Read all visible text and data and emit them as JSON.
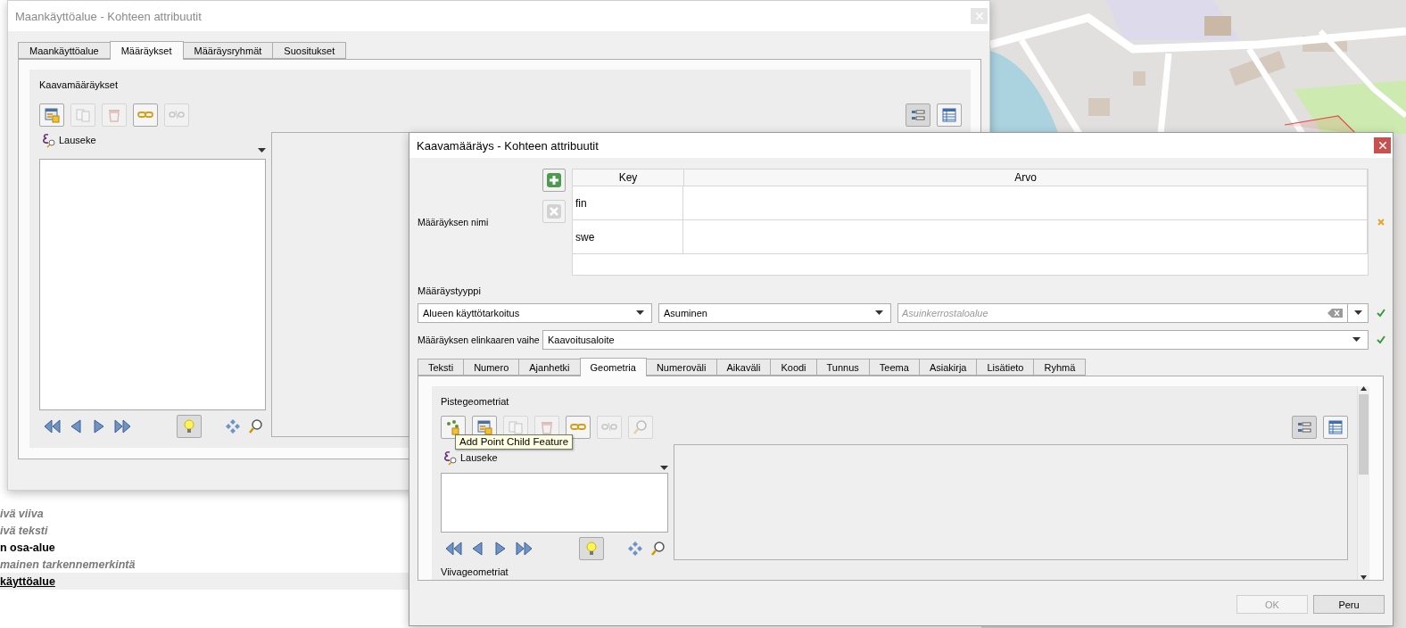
{
  "layers": [
    {
      "label": "ivä viiva",
      "kind": "italic",
      "selected": false
    },
    {
      "label": "ivä teksti",
      "kind": "italic",
      "selected": false
    },
    {
      "label": "n osa-alue",
      "kind": "bold",
      "selected": false
    },
    {
      "label": "mainen tarkennemerkintä",
      "kind": "italic",
      "selected": false
    },
    {
      "label": "käyttöalue",
      "kind": "bold",
      "selected": true
    }
  ],
  "background_window": {
    "title": "Maankäyttöalue - Kohteen attribuutit",
    "active": false,
    "tabs": [
      {
        "label": "Maankäyttöalue",
        "selected": false
      },
      {
        "label": "Määräykset",
        "selected": true
      },
      {
        "label": "Määräysryhmät",
        "selected": false
      },
      {
        "label": "Suositukset",
        "selected": false
      }
    ],
    "section_title": "Kaavamääräykset",
    "toolbar": [
      {
        "kind": "add-form",
        "disabled": false
      },
      {
        "kind": "duplicate",
        "disabled": true
      },
      {
        "kind": "delete",
        "disabled": true
      },
      {
        "kind": "link",
        "disabled": false
      },
      {
        "kind": "unlink",
        "disabled": true
      }
    ],
    "view_buttons": [
      {
        "kind": "form-view",
        "selected": true
      },
      {
        "kind": "table-view",
        "selected": false
      }
    ],
    "expression_label": "Lauseke"
  },
  "dialog": {
    "title": "Kaavamääräys - Kohteen attribuutit",
    "active": true,
    "name_field": {
      "label": "Määräyksen nimi",
      "buttons": [
        {
          "kind": "add",
          "disabled": false
        },
        {
          "kind": "remove",
          "disabled": true
        }
      ],
      "columns": [
        "Key",
        "Arvo"
      ],
      "rows": [
        {
          "key": "fin"
        },
        {
          "key": "swe"
        }
      ],
      "valid": false
    },
    "type_label": "Määräystyyppi",
    "type_combos": [
      "Alueen käyttötarkoitus",
      "Asuminen"
    ],
    "type_field": {
      "placeholder": "Asuinkerrostaloalue",
      "valid": true
    },
    "lifecycle": {
      "label": "Määräyksen elinkaaren vaihe",
      "value": "Kaavoitusaloite",
      "valid": true
    },
    "tabs": [
      {
        "label": "Teksti",
        "selected": false
      },
      {
        "label": "Numero",
        "selected": false
      },
      {
        "label": "Ajanhetki",
        "selected": false
      },
      {
        "label": "Geometria",
        "selected": true
      },
      {
        "label": "Numeroväli",
        "selected": false
      },
      {
        "label": "Aikaväli",
        "selected": false
      },
      {
        "label": "Koodi",
        "selected": false
      },
      {
        "label": "Tunnus",
        "selected": false
      },
      {
        "label": "Teema",
        "selected": false
      },
      {
        "label": "Asiakirja",
        "selected": false
      },
      {
        "label": "Lisätieto",
        "selected": false
      },
      {
        "label": "Ryhmä",
        "selected": false
      }
    ],
    "point_section": {
      "title": "Pistegeometriat",
      "toolbar": [
        {
          "kind": "add-point",
          "disabled": false
        },
        {
          "kind": "add-form",
          "disabled": false
        },
        {
          "kind": "duplicate",
          "disabled": true
        },
        {
          "kind": "delete",
          "disabled": true
        },
        {
          "kind": "link",
          "disabled": false
        },
        {
          "kind": "unlink",
          "disabled": true
        },
        {
          "kind": "zoom",
          "disabled": true
        }
      ],
      "view_buttons": [
        {
          "kind": "form-view",
          "selected": true
        },
        {
          "kind": "table-view",
          "selected": false
        }
      ],
      "tooltip": "Add Point Child Feature",
      "expression_label": "Lauseke"
    },
    "line_section_title": "Viivageometriat",
    "buttons": [
      {
        "label": "OK",
        "disabled": true
      },
      {
        "label": "Peru",
        "disabled": false
      }
    ]
  }
}
